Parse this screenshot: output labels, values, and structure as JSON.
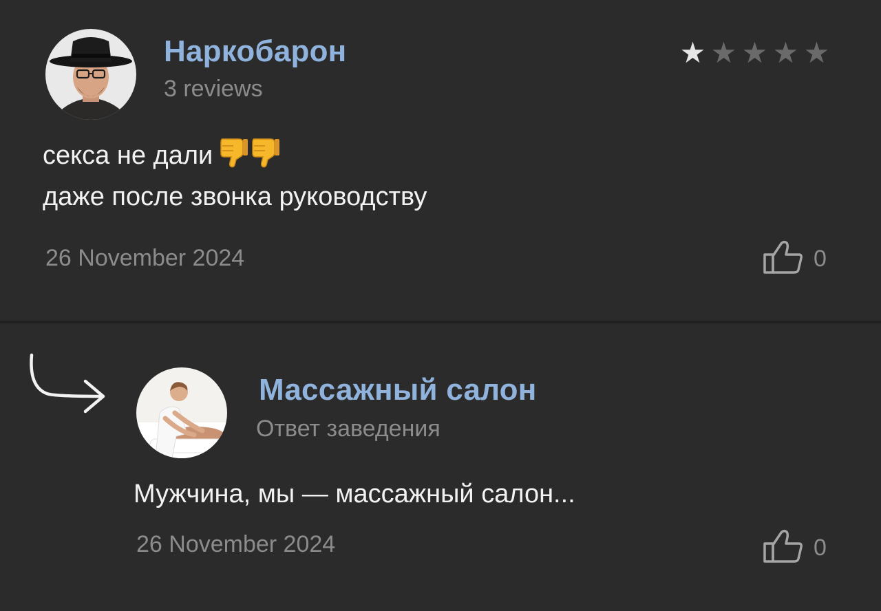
{
  "review": {
    "author_name": "Наркобарон",
    "author_reviews": "3 reviews",
    "rating": 1,
    "rating_max": 5,
    "text_line_1": "секса не дали",
    "text_line_2": "даже после звонка руководству",
    "date": "26 November 2024",
    "likes": "0",
    "icon_avatar": "user-avatar-man-in-hat",
    "icon_emoji": "thumbs-down-emoji",
    "icon_like": "thumbs-up-icon",
    "star_filled_color": "#e6e6e6",
    "star_empty_color": "#6a6a6a"
  },
  "reply": {
    "author_name": "Массажный салон",
    "author_label": "Ответ заведения",
    "text": "Мужчина, мы — массажный салон...",
    "date": "26 November 2024",
    "likes": "0",
    "icon_arrow": "reply-arrow-icon",
    "icon_avatar": "business-avatar-massage",
    "icon_like": "thumbs-up-icon"
  },
  "colors": {
    "background": "#2b2b2b",
    "author_name": "#8fb3dd",
    "text": "#f2f2f2",
    "muted": "#8c8c8c"
  }
}
